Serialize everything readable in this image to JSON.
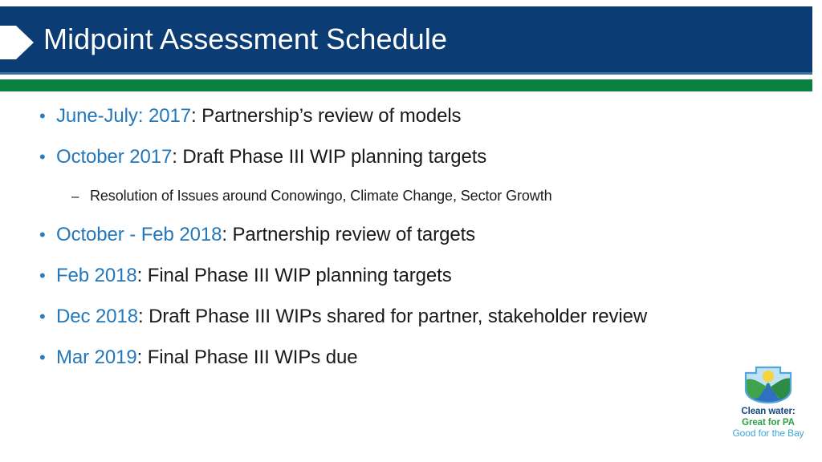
{
  "slide": {
    "title": "Midpoint Assessment Schedule",
    "colors": {
      "banner_blue": "#0B3D74",
      "banner_underline": "#3C6E9E",
      "accent_green": "#0A8140",
      "highlight_blue": "#2377BB",
      "body_text": "#1A1A1A",
      "background": "#FFFFFF"
    }
  },
  "bullets": [
    {
      "level": 1,
      "marker": "•",
      "highlight": "June-July: 2017",
      "rest": ": Partnership’s review of models"
    },
    {
      "level": 1,
      "marker": "•",
      "highlight": "October 2017",
      "rest": ": Draft Phase III WIP planning targets"
    },
    {
      "level": 2,
      "marker": "–",
      "highlight": "",
      "rest": "Resolution of Issues around Conowingo, Climate Change, Sector Growth"
    },
    {
      "level": 1,
      "marker": "•",
      "highlight": "October - Feb 2018",
      "rest": ": Partnership review of targets"
    },
    {
      "level": 1,
      "marker": "•",
      "highlight": "Feb 2018",
      "rest": ": Final Phase III WIP planning targets"
    },
    {
      "level": 1,
      "marker": "•",
      "highlight": "Dec 2018",
      "rest": ": Draft Phase III WIPs shared for partner, stakeholder review"
    },
    {
      "level": 1,
      "marker": "•",
      "highlight": "Mar 2019",
      "rest": ": Final Phase III WIPs due"
    }
  ],
  "logo": {
    "line1": "Clean water:",
    "line2": "Great for PA",
    "line3": "Good for the Bay",
    "mark_colors": {
      "sky": "#BFE3F5",
      "sun": "#F4D33C",
      "hill_left": "#3FA34D",
      "hill_right": "#2E8B46",
      "water": "#2F6FC4",
      "outline": "#4FA8DA"
    }
  }
}
